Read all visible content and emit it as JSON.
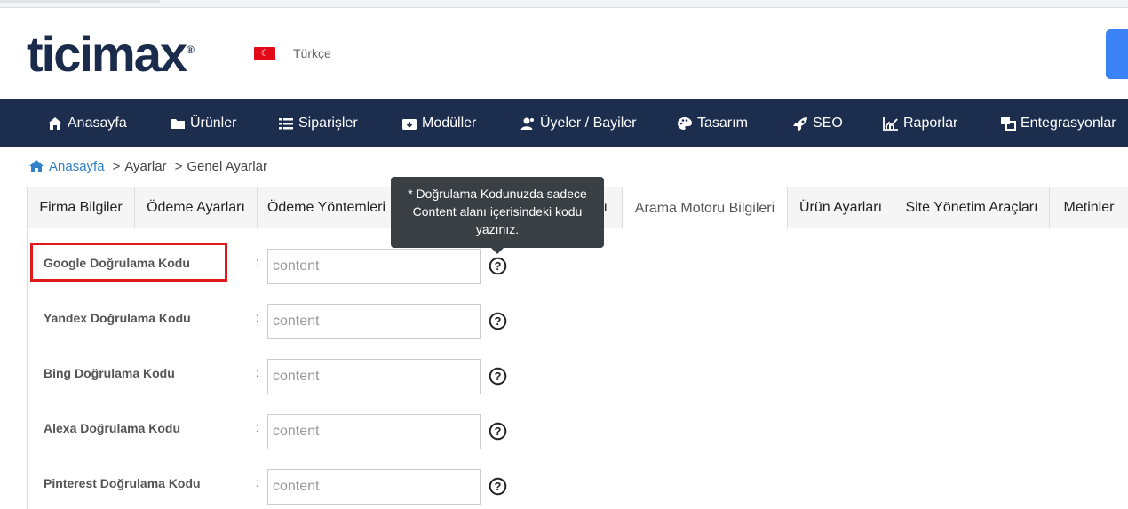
{
  "header": {
    "logo_text": "ticimax",
    "logo_mark": "®",
    "language": "Türkçe",
    "flag_icon": "turkey-flag-icon"
  },
  "nav": {
    "items": [
      {
        "label": "Anasayfa",
        "icon": "home-icon"
      },
      {
        "label": "Ürünler",
        "icon": "folder-icon"
      },
      {
        "label": "Siparişler",
        "icon": "list-icon"
      },
      {
        "label": "Modüller",
        "icon": "module-box-icon"
      },
      {
        "label": "Üyeler / Bayiler",
        "icon": "users-icon"
      },
      {
        "label": "Tasarım",
        "icon": "palette-icon"
      },
      {
        "label": "SEO",
        "icon": "rocket-icon"
      },
      {
        "label": "Raporlar",
        "icon": "chart-icon"
      },
      {
        "label": "Entegrasyonlar",
        "icon": "integration-icon"
      }
    ],
    "background": "#1c2d4d"
  },
  "breadcrumb": {
    "home": "Anasayfa",
    "items": [
      "Ayarlar",
      "Genel Ayarlar"
    ],
    "separator": ">"
  },
  "tabs": [
    {
      "label": "Firma Bilgiler"
    },
    {
      "label": "Ödeme Ayarları"
    },
    {
      "label": "Ödeme Yöntemleri"
    },
    {
      "label": "ı"
    },
    {
      "label": "Arama Motoru Bilgileri",
      "active": true
    },
    {
      "label": "Ürün Ayarları"
    },
    {
      "label": "Site Yönetim Araçları"
    },
    {
      "label": "Metinler"
    }
  ],
  "tooltip": {
    "text": "* Doğrulama Kodunuzda sadece Content alanı içerisindeki kodu yazınız."
  },
  "form": {
    "colon": ":",
    "fields": [
      {
        "label": "Google Doğrulama Kodu",
        "value": "",
        "placeholder": "content"
      },
      {
        "label": "Yandex Doğrulama Kodu",
        "value": "",
        "placeholder": "content"
      },
      {
        "label": "Bing Doğrulama Kodu",
        "value": "",
        "placeholder": "content"
      },
      {
        "label": "Alexa Doğrulama Kodu",
        "value": "",
        "placeholder": "content"
      },
      {
        "label": "Pinterest Doğrulama Kodu",
        "value": "",
        "placeholder": "content"
      }
    ]
  },
  "colors": {
    "accent": "#2f80c8",
    "highlight": "#e01a1a",
    "tooltip_bg": "#3a3f44",
    "header_button": "#3b82f6"
  }
}
